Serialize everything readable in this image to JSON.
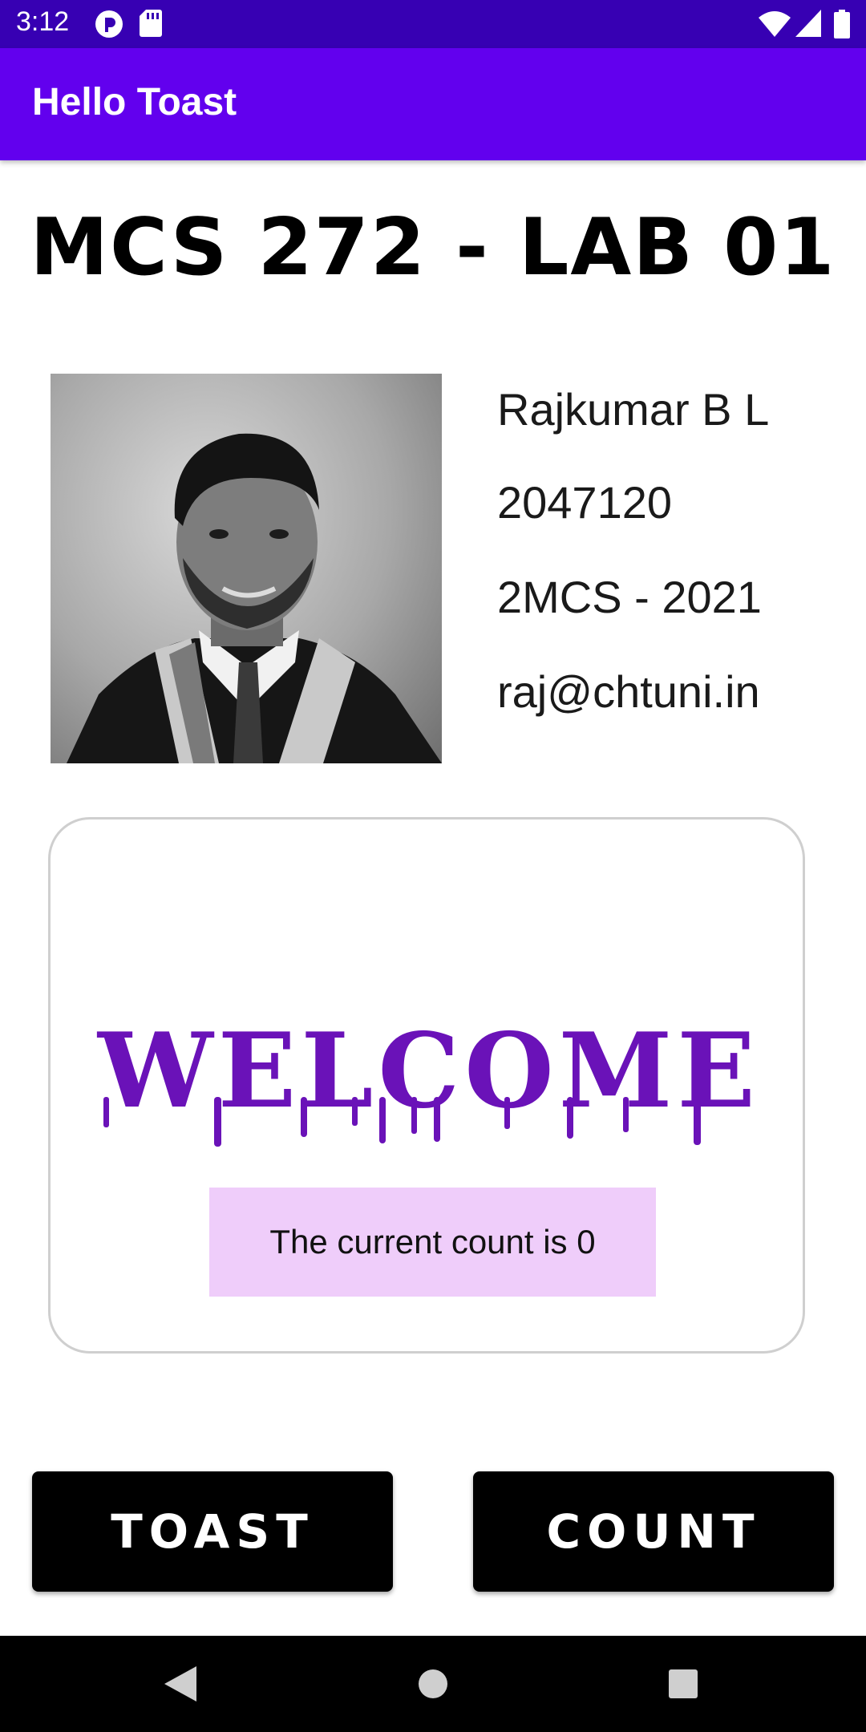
{
  "status_bar": {
    "time": "3:12",
    "icons": [
      "pocket-cast-icon",
      "sd-card-icon",
      "wifi-icon",
      "signal-icon",
      "battery-icon"
    ]
  },
  "app_bar": {
    "title": "Hello Toast"
  },
  "page_title": "MCS 272 - LAB 01",
  "profile": {
    "name": "Rajkumar B L",
    "id": "2047120",
    "class": "2MCS - 2021",
    "email": "raj@chtuni.in"
  },
  "welcome_text": "WELCOME",
  "count_text": "The current count is 0",
  "buttons": {
    "toast": "TOAST",
    "count": "COUNT"
  },
  "nav": {
    "icons": [
      "back-icon",
      "home-icon",
      "recents-icon"
    ]
  },
  "colors": {
    "status_bar": "#3700b3",
    "app_bar": "#6200ee",
    "welcome": "#6a12b8",
    "count_bg": "#efcdfa",
    "button": "#000000"
  }
}
